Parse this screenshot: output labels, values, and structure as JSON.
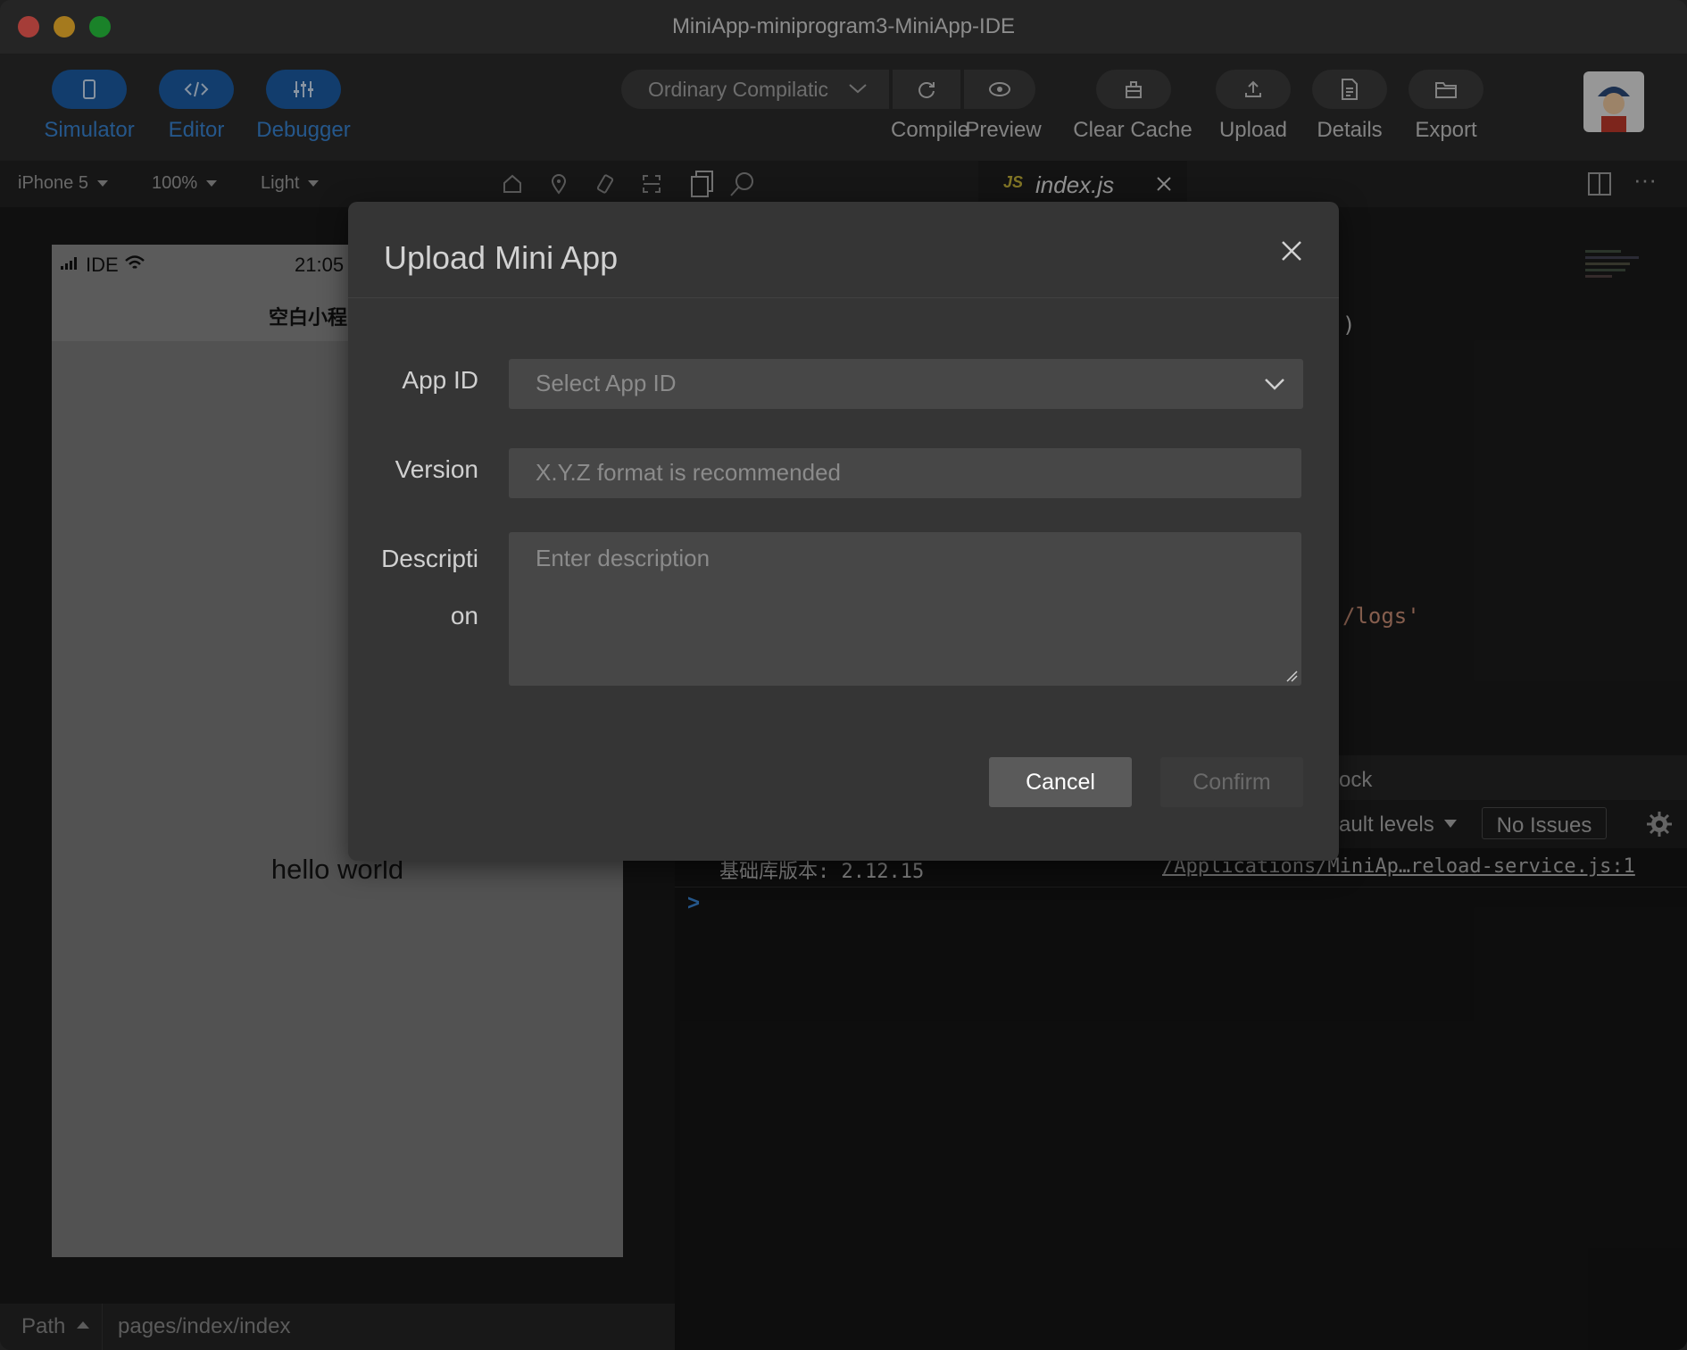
{
  "window": {
    "title": "MiniApp-miniprogram3-MiniApp-IDE"
  },
  "toolbar": {
    "simulator_label": "Simulator",
    "editor_label": "Editor",
    "debugger_label": "Debugger",
    "compile_mode": "Ordinary Compilatic",
    "compile_label": "Compile",
    "preview_label": "Preview",
    "clear_cache_label": "Clear Cache",
    "upload_label": "Upload",
    "details_label": "Details",
    "export_label": "Export"
  },
  "subbar": {
    "device": "iPhone 5",
    "zoom": "100%",
    "theme": "Light"
  },
  "tab": {
    "file": "index.js",
    "lang_badge": "JS"
  },
  "simulator": {
    "carrier": "IDE",
    "time": "21:05",
    "nav_title": "空白小程",
    "content": "hello world"
  },
  "editor": {
    "visible_paren": ")",
    "visible_logs": "/logs'"
  },
  "console": {
    "tab_partial": "ock",
    "levels_partial": "ault levels",
    "issues_label": "No Issues",
    "log_message": "基础库版本: 2.12.15",
    "log_source": "/Applications/MiniAp…reload-service.js:1",
    "prompt": ">"
  },
  "pathbar": {
    "path_label": "Path",
    "path_value": "pages/index/index"
  },
  "modal": {
    "title": "Upload Mini App",
    "app_id_label": "App ID",
    "app_id_placeholder": "Select App ID",
    "version_label": "Version",
    "version_placeholder": "X.Y.Z format is recommended",
    "description_label_1": "Descripti",
    "description_label_2": "on",
    "description_placeholder": "Enter description",
    "cancel_label": "Cancel",
    "confirm_label": "Confirm"
  },
  "colors": {
    "accent_blue": "#1c5fa8",
    "accent_text": "#3a86d6",
    "modal_bg": "#353535",
    "field_bg": "#474747"
  }
}
